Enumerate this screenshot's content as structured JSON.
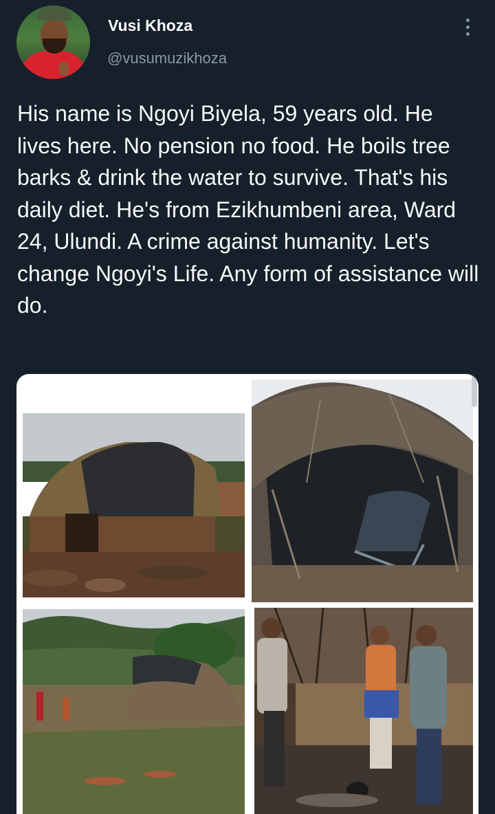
{
  "tweet": {
    "author": {
      "display_name": "Vusi Khoza",
      "handle": "@vusumuzikhoza"
    },
    "text": "His name is Ngoyi Biyela, 59 years old. He lives here. No pension no food. He boils tree barks & drink the water to survive. That's his daily diet. He's from Ezikhumbeni area, Ward 24, Ulundi. A crime against humanity. Let's change Ngoyi's Life. Any form of assistance will do.",
    "more_icon": "more-vertical-icon",
    "media": {
      "count": 4,
      "photos": [
        {
          "subject": "thatched hut covered with black tarpaulin"
        },
        {
          "subject": "collapsed hut interior"
        },
        {
          "subject": "ruined hut in green valley with people"
        },
        {
          "subject": "three men beside the hut"
        }
      ]
    }
  },
  "colors": {
    "background": "#15202b",
    "text": "#f7f9f9",
    "secondary_text": "#8b98a5"
  }
}
